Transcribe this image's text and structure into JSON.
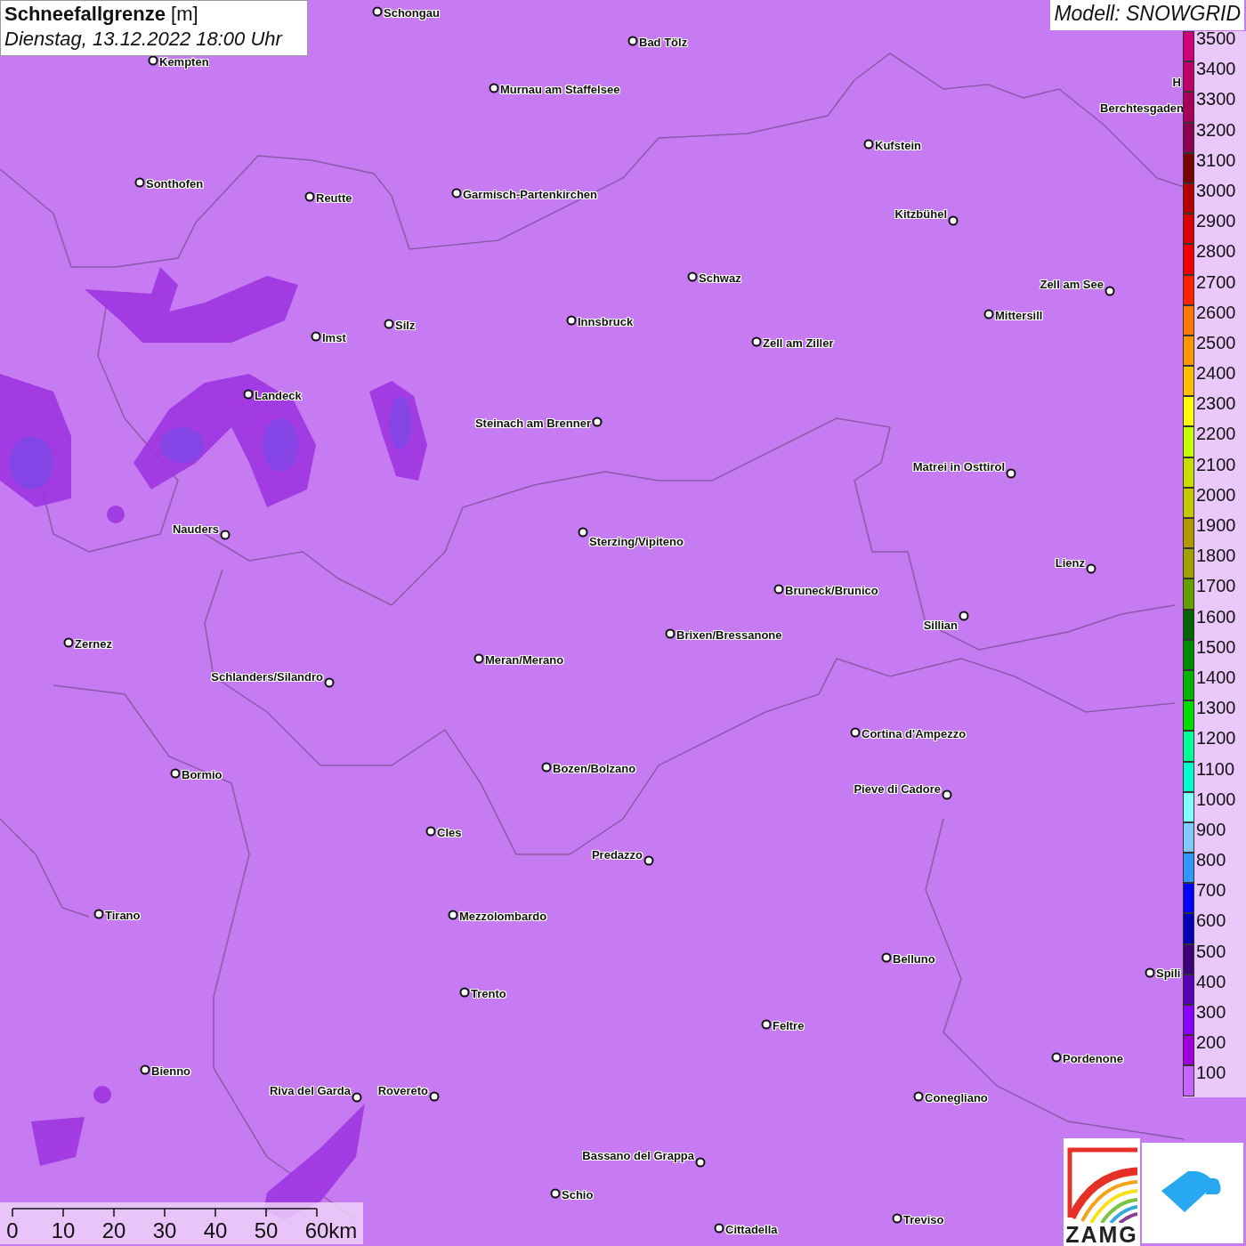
{
  "title": {
    "text": "**Schneefallgrenze** [m]",
    "date": "Dienstag, 13.12.2022 18:00 Uhr"
  },
  "model": "Modell: SNOWGRID",
  "cities": [
    {
      "name": "Schongau"
    },
    {
      "name": "Bad Tölz"
    },
    {
      "name": "Kempten"
    },
    {
      "name": "Murnau am Staffelsee"
    },
    {
      "name": "H"
    },
    {
      "name": "Berchtesgaden"
    },
    {
      "name": "Kufstein"
    },
    {
      "name": "Sonthofen"
    },
    {
      "name": "Reutte"
    },
    {
      "name": "Garmisch-Partenkirchen"
    },
    {
      "name": "Kitzbühel"
    },
    {
      "name": "Schwaz"
    },
    {
      "name": "Zell am See"
    },
    {
      "name": "Mittersill"
    },
    {
      "name": "Innsbruck"
    },
    {
      "name": "Silz"
    },
    {
      "name": "Imst"
    },
    {
      "name": "Zell am Ziller"
    },
    {
      "name": "Landeck"
    },
    {
      "name": "Steinach am Brenner"
    },
    {
      "name": "Matrei in Osttirol"
    },
    {
      "name": "Nauders"
    },
    {
      "name": "Sterzing/Vipiteno"
    },
    {
      "name": "Lienz"
    },
    {
      "name": "Bruneck/Brunico"
    },
    {
      "name": "Sillian"
    },
    {
      "name": "Brixen/Bressanone"
    },
    {
      "name": "Zernez"
    },
    {
      "name": "Meran/Merano"
    },
    {
      "name": "Schlanders/Silandro"
    },
    {
      "name": "Cortina d'Ampezzo"
    },
    {
      "name": "Bozen/Bolzano"
    },
    {
      "name": "Bormio"
    },
    {
      "name": "Pieve di Cadore"
    },
    {
      "name": "Cles"
    },
    {
      "name": "Predazzo"
    },
    {
      "name": "Tirano"
    },
    {
      "name": "Mezzolombardo"
    },
    {
      "name": "Belluno"
    },
    {
      "name": "Spili"
    },
    {
      "name": "Trento"
    },
    {
      "name": "Feltre"
    },
    {
      "name": "Pordenone"
    },
    {
      "name": "Bienno"
    },
    {
      "name": "Riva del Garda"
    },
    {
      "name": "Rovereto"
    },
    {
      "name": "Conegliano"
    },
    {
      "name": "Bassano del Grappa"
    },
    {
      "name": "Schio"
    },
    {
      "name": "Treviso"
    },
    {
      "name": "Cittadella"
    }
  ],
  "legend": [
    {
      "label": "3500",
      "color": "#d0007a"
    },
    {
      "label": "3400",
      "color": "#c0006a"
    },
    {
      "label": "3300",
      "color": "#a8005a"
    },
    {
      "label": "3200",
      "color": "#8c0050"
    },
    {
      "label": "3100",
      "color": "#780000"
    },
    {
      "label": "3000",
      "color": "#b40000"
    },
    {
      "label": "2900",
      "color": "#d80000"
    },
    {
      "label": "2800",
      "color": "#f00000"
    },
    {
      "label": "2700",
      "color": "#ff2000"
    },
    {
      "label": "2600",
      "color": "#ff7800"
    },
    {
      "label": "2500",
      "color": "#ff9600"
    },
    {
      "label": "2400",
      "color": "#ffbe00"
    },
    {
      "label": "2300",
      "color": "#ffff00"
    },
    {
      "label": "2200",
      "color": "#c8ff00"
    },
    {
      "label": "2100",
      "color": "#c8dc00"
    },
    {
      "label": "2000",
      "color": "#c8c800"
    },
    {
      "label": "1900",
      "color": "#b49600"
    },
    {
      "label": "1800",
      "color": "#a0a000"
    },
    {
      "label": "1700",
      "color": "#64a000"
    },
    {
      "label": "1600",
      "color": "#006400"
    },
    {
      "label": "1500",
      "color": "#008c00"
    },
    {
      "label": "1400",
      "color": "#00b400"
    },
    {
      "label": "1300",
      "color": "#00dc00"
    },
    {
      "label": "1200",
      "color": "#00ff96"
    },
    {
      "label": "1100",
      "color": "#00ffc8"
    },
    {
      "label": "1000",
      "color": "#80ffff"
    },
    {
      "label": "900",
      "color": "#80c8ff"
    },
    {
      "label": "800",
      "color": "#3296ff"
    },
    {
      "label": "700",
      "color": "#0000ff"
    },
    {
      "label": "600",
      "color": "#0000b4"
    },
    {
      "label": "500",
      "color": "#3c0078"
    },
    {
      "label": "400",
      "color": "#5a00b4"
    },
    {
      "label": "300",
      "color": "#8c00ff"
    },
    {
      "label": "200",
      "color": "#a000dc"
    },
    {
      "label": "100",
      "color": "#c864ff"
    }
  ],
  "scale": [
    "0",
    "10",
    "20",
    "30",
    "40",
    "50",
    "60km"
  ],
  "logo": {
    "text": "ZAMG"
  }
}
